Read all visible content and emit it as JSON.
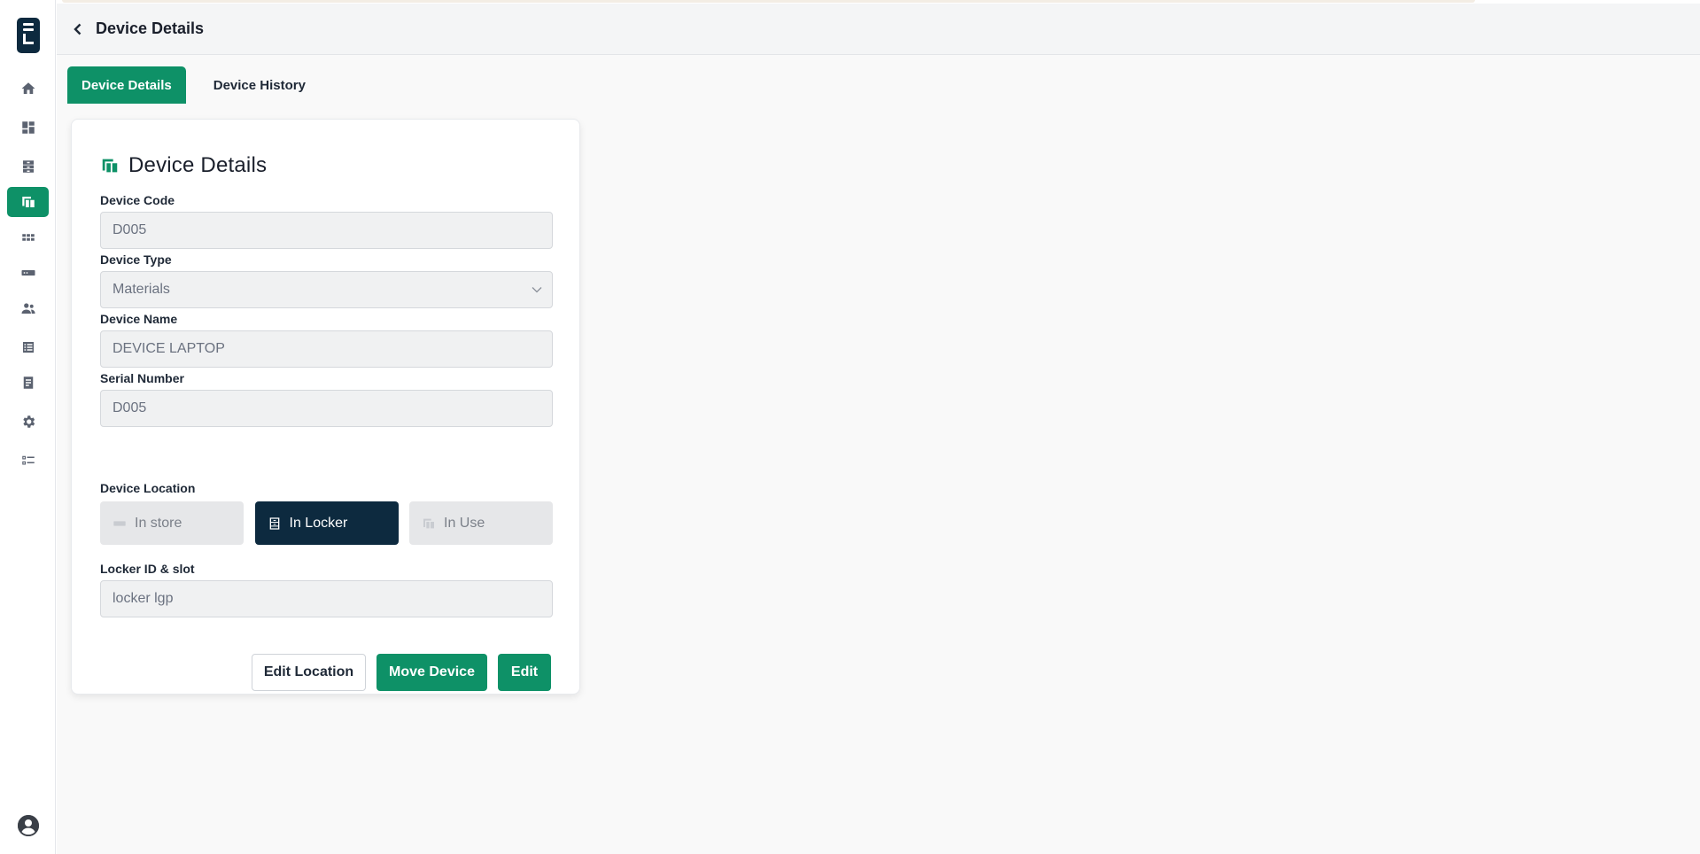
{
  "app": {
    "logo_letter": "L"
  },
  "sidebar": {
    "items": [
      {
        "name": "home",
        "icon": "home-icon",
        "active": false
      },
      {
        "name": "dashboard",
        "icon": "dashboard-icon",
        "active": false
      },
      {
        "name": "lockers",
        "icon": "locker-icon",
        "active": false
      },
      {
        "name": "devices",
        "icon": "devices-icon",
        "active": true
      },
      {
        "name": "apps",
        "icon": "grid-icon",
        "active": false
      },
      {
        "name": "store",
        "icon": "storage-icon",
        "active": false
      },
      {
        "name": "users",
        "icon": "users-icon",
        "active": false
      },
      {
        "name": "lists",
        "icon": "list-icon",
        "active": false
      },
      {
        "name": "reports",
        "icon": "document-icon",
        "active": false
      },
      {
        "name": "settings",
        "icon": "gear-icon",
        "active": false
      },
      {
        "name": "checklist",
        "icon": "checklist-icon",
        "active": false
      }
    ],
    "profile_icon": "account-circle-icon"
  },
  "header": {
    "title": "Device Details",
    "back_icon": "chevron-left-icon"
  },
  "tabs": [
    {
      "label": "Device Details",
      "active": true
    },
    {
      "label": "Device History",
      "active": false
    }
  ],
  "card": {
    "title": "Device Details",
    "title_icon": "devices-icon",
    "fields": {
      "device_code": {
        "label": "Device Code",
        "value": "D005"
      },
      "device_type": {
        "label": "Device Type",
        "value": "Materials"
      },
      "device_name": {
        "label": "Device Name",
        "value": "DEVICE LAPTOP"
      },
      "serial_number": {
        "label": "Serial Number",
        "value": "D005"
      },
      "device_location": {
        "label": "Device Location",
        "options": [
          {
            "label": "In store",
            "icon": "storage-icon",
            "selected": false
          },
          {
            "label": "In Locker",
            "icon": "locker-icon",
            "selected": true
          },
          {
            "label": "In Use",
            "icon": "devices-icon",
            "selected": false
          }
        ]
      },
      "locker": {
        "label": "Locker ID & slot",
        "value": "locker lgp"
      }
    },
    "actions": {
      "edit_location": "Edit Location",
      "move_device": "Move Device",
      "edit": "Edit"
    }
  },
  "colors": {
    "accent": "#0e9167",
    "dark": "#0d2a3f",
    "header_bg": "#f4f5f6",
    "content_bg": "#f9f9f9"
  }
}
